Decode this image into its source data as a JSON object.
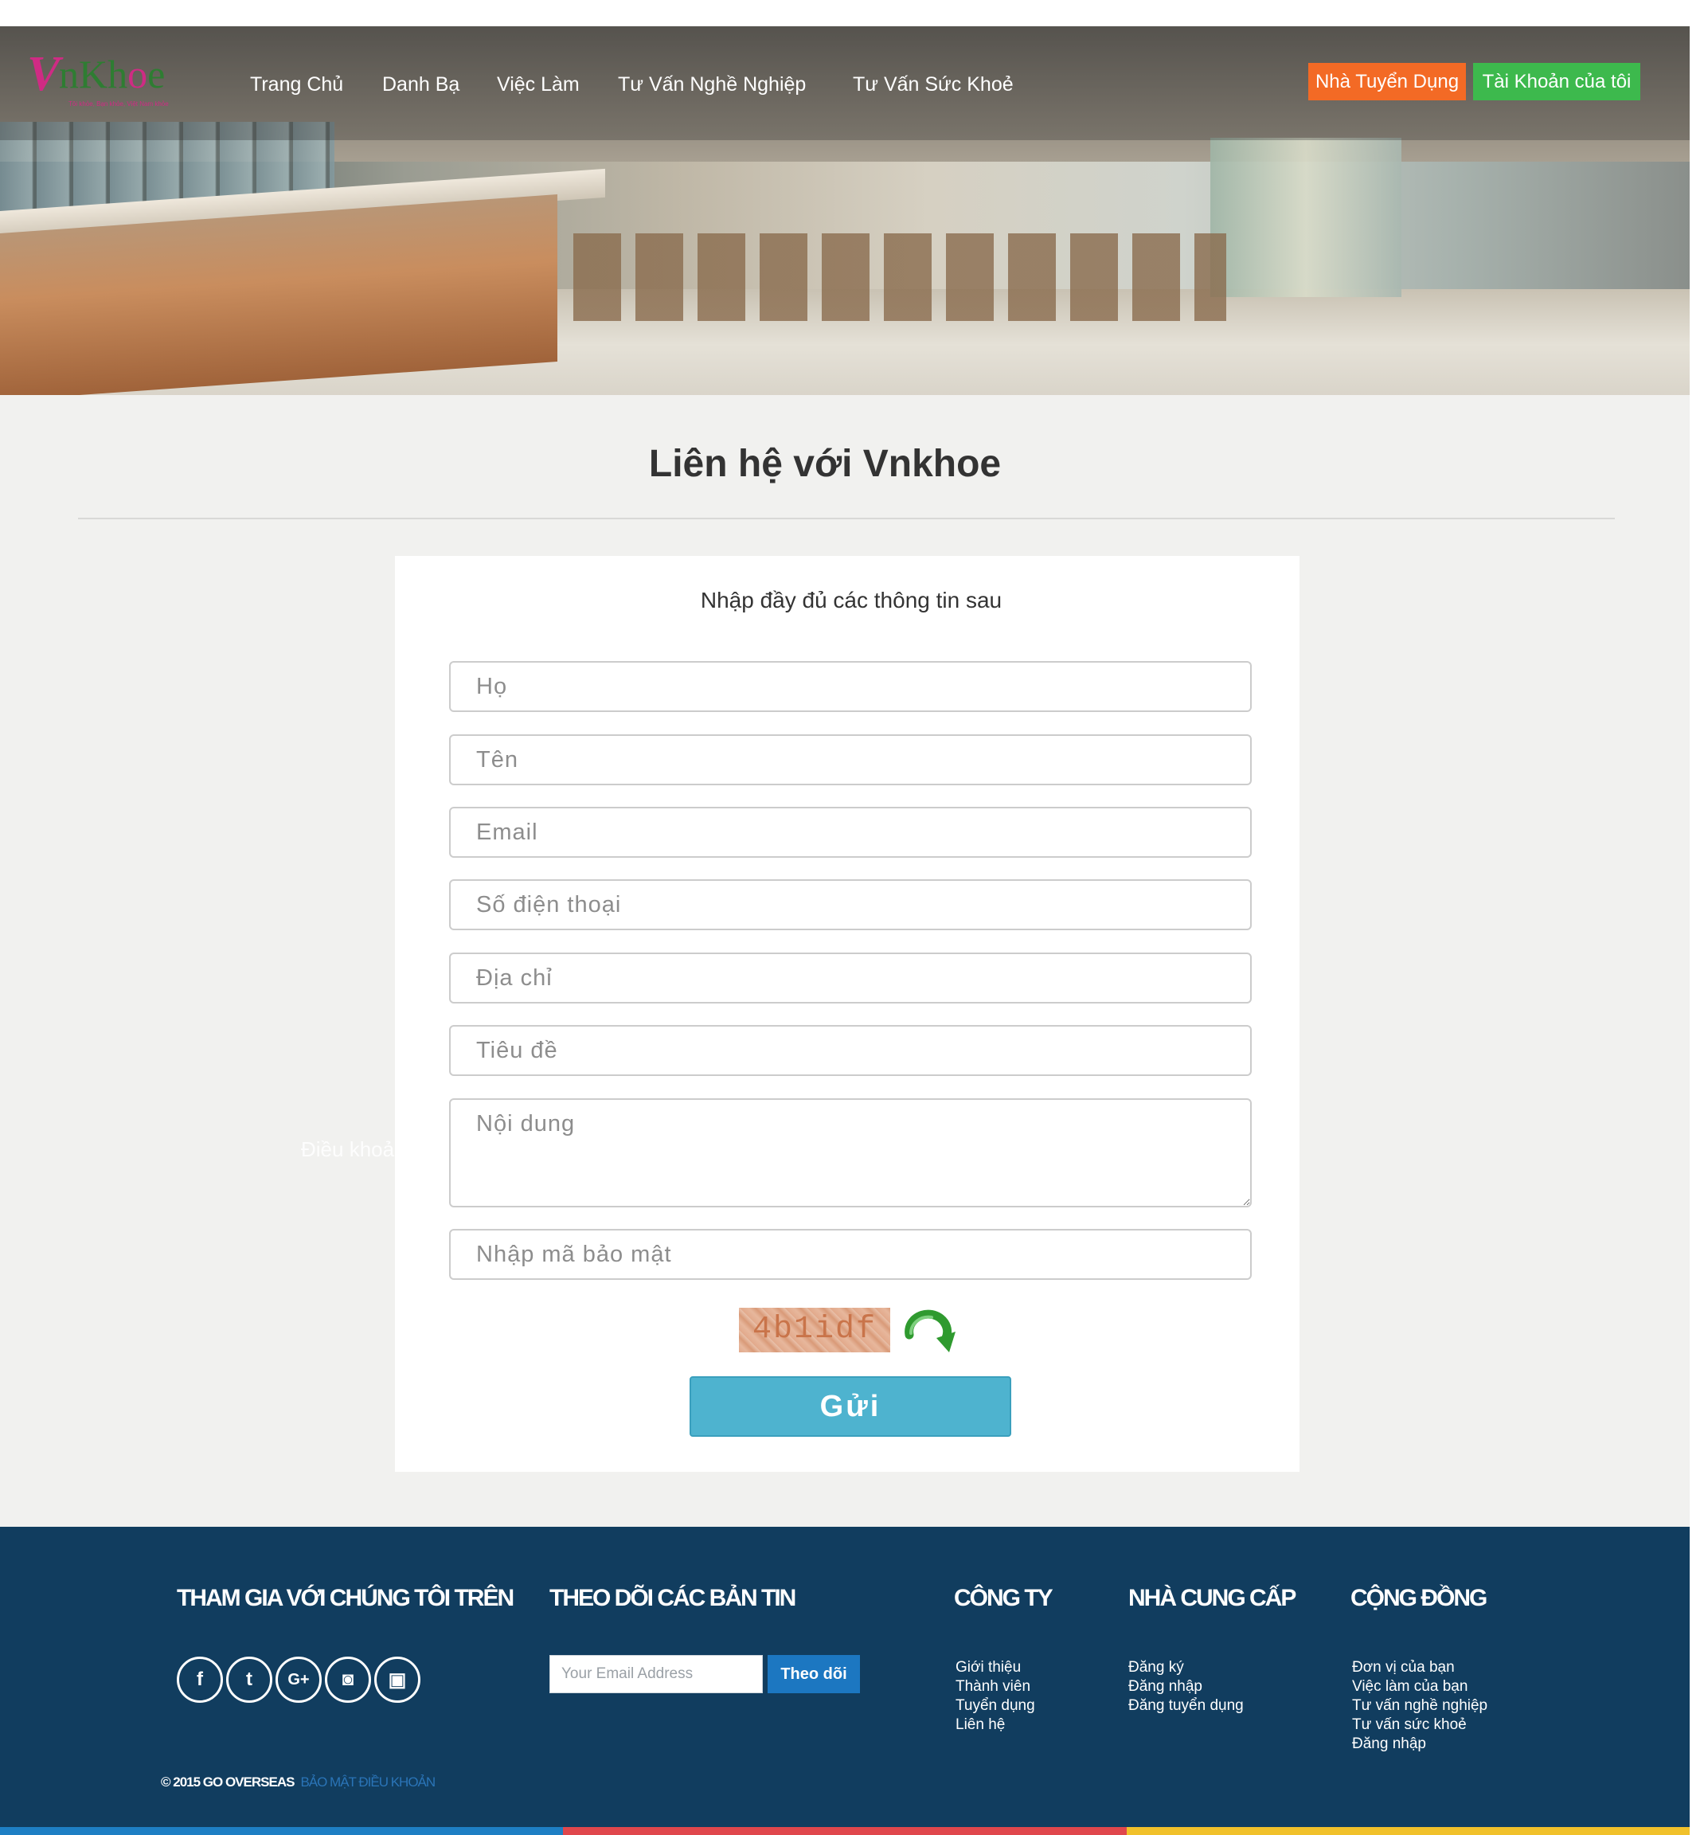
{
  "brand": {
    "logo_mark": "V",
    "logo_word_prefix": "nKh",
    "logo_word_accent": "o",
    "logo_word_suffix": "e",
    "tagline": "Tôi khỏe, Bạn khỏe, Việt Nam khỏe",
    "colors": {
      "pink": "#cf2b84",
      "green": "#2e7d32"
    }
  },
  "nav": {
    "items": [
      {
        "label": "Trang Chủ"
      },
      {
        "label": "Danh Bạ"
      },
      {
        "label": "Việc Làm"
      },
      {
        "label": "Tư Vấn Nghề Nghiệp"
      },
      {
        "label": "Tư Vấn Sức Khoẻ"
      }
    ],
    "employer_button": "Nhà Tuyển Dụng",
    "account_button": "Tài Khoản của tôi",
    "colors": {
      "employer": "#f36a25",
      "account": "#3db94d"
    }
  },
  "page": {
    "title": "Liên hệ với Vnkhoe",
    "ghost_text": "Điều khoả"
  },
  "form": {
    "heading": "Nhập đầy đủ các thông tin sau",
    "fields": {
      "last_name": {
        "placeholder": "Họ",
        "value": ""
      },
      "first_name": {
        "placeholder": "Tên",
        "value": ""
      },
      "email": {
        "placeholder": "Email",
        "value": ""
      },
      "phone": {
        "placeholder": "Số điện thoại",
        "value": ""
      },
      "address": {
        "placeholder": "Địa chỉ",
        "value": ""
      },
      "subject": {
        "placeholder": "Tiêu đề",
        "value": ""
      },
      "content": {
        "placeholder": "Nội dung",
        "value": ""
      },
      "security_code": {
        "placeholder": "Nhập mã bảo mật",
        "value": ""
      }
    },
    "captcha_text": "4b1idf",
    "refresh_icon": "refresh-arrow-icon",
    "submit_label": "Gửi",
    "submit_color": "#4eb3cf"
  },
  "footer": {
    "background": "#113d5f",
    "join_heading": "THAM GIA VỚI CHÚNG TÔI TRÊN",
    "social_icons": [
      {
        "icon": "facebook-icon",
        "glyph": "f"
      },
      {
        "icon": "twitter-icon",
        "glyph": "t"
      },
      {
        "icon": "google-plus-icon",
        "glyph": "G+"
      },
      {
        "icon": "instagram-icon",
        "glyph": "◙"
      },
      {
        "icon": "youtube-icon",
        "glyph": "▣"
      }
    ],
    "newsletter_heading": "THEO DÕI CÁC BẢN TIN",
    "newsletter_placeholder": "Your Email Address",
    "newsletter_button": "Theo dõi",
    "company": {
      "heading": "CÔNG TY",
      "links": [
        "Giới thiệu",
        "Thành viên",
        "Tuyển dụng",
        "Liên hệ"
      ]
    },
    "supplier": {
      "heading": "NHÀ CUNG CẤP",
      "links": [
        "Đăng ký",
        "Đăng nhập",
        "Đăng tuyển dụng"
      ]
    },
    "community": {
      "heading": "CỘNG ĐỒNG",
      "links": [
        "Đơn vị của bạn",
        "Việc làm của bạn",
        "Tư vấn nghề nghiệp",
        "Tư vấn sức khoẻ",
        "Đăng nhập"
      ]
    },
    "copyright": "© 2015 GO OVERSEAS",
    "legal_links": "BẢO MẬT ĐIỀU KHOẢN",
    "bottom_bar_colors": [
      "#1e7fc4",
      "#e0474c",
      "#f1c12b"
    ]
  }
}
